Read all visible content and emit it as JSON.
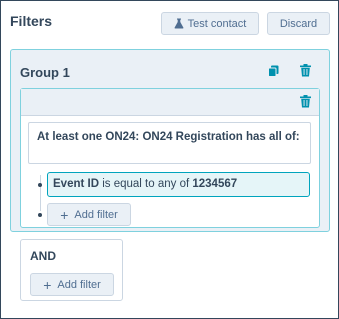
{
  "header": {
    "title": "Filters",
    "test_contact_label": "Test contact",
    "discard_label": "Discard"
  },
  "group": {
    "title": "Group 1",
    "condition": "At least one ON24: ON24 Registration has all of:",
    "filter": {
      "property": "Event ID",
      "operator": " is equal to any of ",
      "value": "1234567"
    },
    "add_filter_label": "Add filter"
  },
  "and_block": {
    "label": "AND",
    "add_filter_label": "Add filter"
  },
  "icons": {
    "test_contact": "flask-icon",
    "copy": "copy-icon",
    "delete": "trash-icon",
    "add": "plus-icon"
  },
  "colors": {
    "accent": "#0091ae",
    "selected_border": "#00a4bd",
    "selected_fill": "#e5f5f8",
    "panel_bg": "#eaf0f6",
    "text": "#33475b"
  }
}
